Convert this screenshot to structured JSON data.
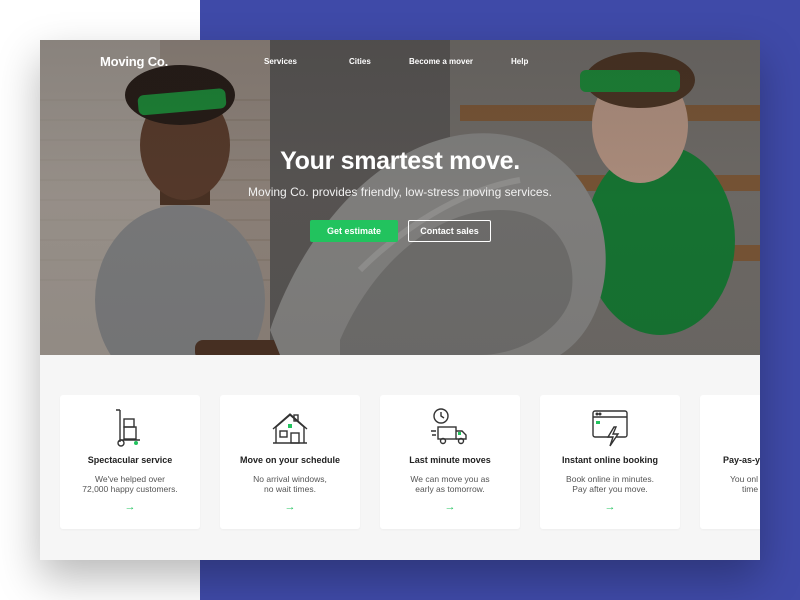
{
  "nav": {
    "brand": "Moving Co.",
    "links": [
      "Services",
      "Cities",
      "Become a mover",
      "Help"
    ]
  },
  "hero": {
    "title": "Your smartest move.",
    "subtitle": "Moving Co. provides friendly, low-stress moving services.",
    "primary_button": "Get estimate",
    "secondary_button": "Contact sales"
  },
  "cards": [
    {
      "title": "Spectacular service",
      "desc": [
        "We've helped over",
        "72,000 happy customers."
      ],
      "icon": "hand-truck-icon"
    },
    {
      "title": "Move on your schedule",
      "desc": [
        "No arrival windows,",
        "no wait times."
      ],
      "icon": "house-icon"
    },
    {
      "title": "Last minute moves",
      "desc": [
        "We can move you as",
        "early as tomorrow."
      ],
      "icon": "clock-truck-icon"
    },
    {
      "title": "Instant online booking",
      "desc": [
        "Book online in minutes.",
        "Pay after you move."
      ],
      "icon": "browser-lightning-icon"
    },
    {
      "title": "Pay-as-y",
      "desc": [
        "You onl",
        "time"
      ],
      "icon": "partial-icon"
    }
  ],
  "card_arrow": "→",
  "colors": {
    "accent_background": "#3f4aa8",
    "brand_green": "#22c35e",
    "headband_green": "#1fa83f",
    "card_background": "#ffffff",
    "section_background": "#f6f6f6"
  }
}
